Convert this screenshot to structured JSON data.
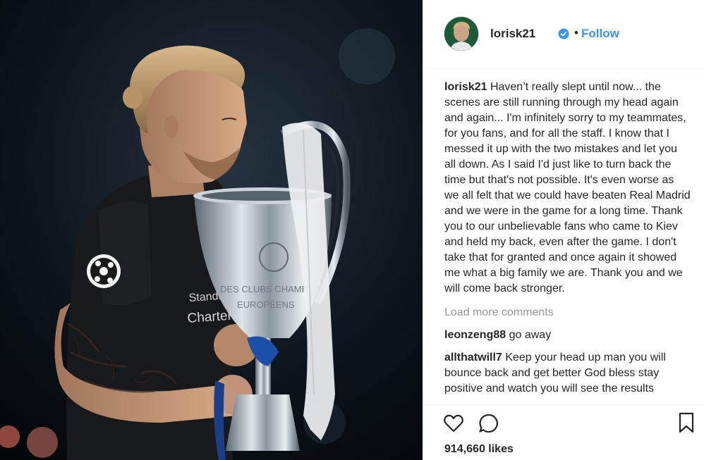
{
  "post": {
    "author": "lorisk21",
    "follow_label": "Follow",
    "separator": "•",
    "caption_text": "Haven’t really slept until now... the scenes are still running through my head again and again... I'm infinitely sorry to my teammates, for you fans, and for all the staff. I know that I messed it up with the two mistakes and let you all down. As I said I'd just like to turn back the time but that's not possible. It's even worse as we all felt that we could have beaten Real Madrid and we were in the game for a long time. Thank you to our unbelievable fans who came to Kiev and held my back, even after the game. I don't take that for granted and once again it showed me what a big family we are. Thank you and we will come back stronger.",
    "load_more": "Load more comments",
    "comments": [
      {
        "user": "leonzeng88",
        "text": "go away"
      },
      {
        "user": "allthatwill7",
        "text": "Keep your head up man you will bounce back and get better God bless stay positive and watch you will see the results"
      }
    ],
    "likes": "914,660 likes"
  },
  "photo": {
    "jersey_sponsor": "Standard Chartered",
    "trophy_text_1": "DES CLUBS CHAMP",
    "trophy_text_2": "EUROPÉENS"
  },
  "icons": {
    "verified": "verified-badge-icon",
    "like": "heart-icon",
    "comment": "comment-bubble-icon",
    "save": "bookmark-icon"
  },
  "colors": {
    "link_blue": "#3897f0",
    "text": "#262626",
    "muted": "#999999",
    "divider": "#efefef"
  }
}
